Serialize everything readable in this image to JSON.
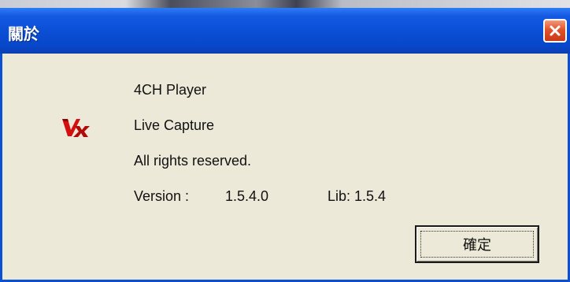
{
  "window": {
    "title": "關於",
    "close_icon": "close-icon",
    "colors": {
      "titlebar": "#0a4fd6",
      "body": "#ece9d8",
      "close": "#e0522a"
    }
  },
  "about": {
    "logo_icon": "vx-logo",
    "product_name": "4CH Player",
    "subtitle": "Live Capture",
    "rights": "All rights reserved.",
    "version_label": "Version :",
    "version_value": "1.5.4.0",
    "lib_label": "Lib: 1.5.4"
  },
  "buttons": {
    "ok_label": "確定"
  }
}
